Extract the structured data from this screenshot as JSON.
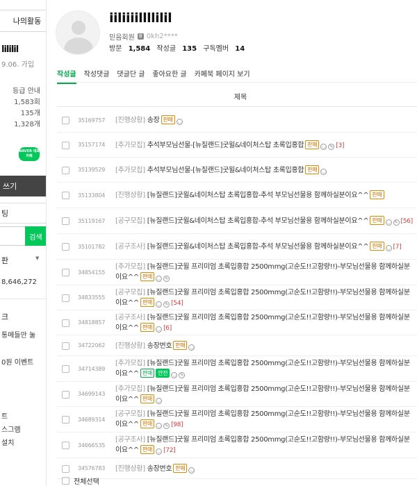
{
  "sidebar": {
    "tab_label": "나의활동",
    "nickname": "lililil",
    "join_date": "9.06. 가입",
    "grade_guide": "등급 안내",
    "visit_count": "1,583회",
    "post_count": "135개",
    "comment_count": "1,328개",
    "naver_badge": "NAVER 대표카페",
    "write_button": "쓰기",
    "box_label": "팅",
    "search_button": "검색",
    "section_label": "판",
    "member_count": "8,646,272",
    "section2_label": "크",
    "menu1": "통메들만 눌",
    "menu2": "0원 이벤트",
    "menu3": "트",
    "menu4": "스그램",
    "menu5": "설치"
  },
  "profile": {
    "nickname": "iiliiiillllilil",
    "grade": "믿음회원",
    "user_id": "0kh2****",
    "visit_label": "방문",
    "visit_value": "1,584",
    "posts_label": "작성글",
    "posts_value": "135",
    "subs_label": "구독멤버",
    "subs_value": "14"
  },
  "tabs": [
    {
      "label": "작성글"
    },
    {
      "label": "작성댓글"
    },
    {
      "label": "댓글단 글"
    },
    {
      "label": "좋아요한 글"
    },
    {
      "label": "카페북 페이지 보기"
    }
  ],
  "table_header": "제목",
  "rows": [
    {
      "id": "35169757",
      "cat": "[진행상황]",
      "text": "송장",
      "tags": [
        "판매"
      ],
      "icons": 1,
      "comments": ""
    },
    {
      "id": "35157174",
      "cat": "[추가모집]",
      "text": "추석부모님선물-[뉴질랜드]굿윌&네이처스탑 초록입홍합",
      "tags": [
        "판매"
      ],
      "icons": 2,
      "comments": "[3]"
    },
    {
      "id": "35139529",
      "cat": "[추가모집]",
      "text": "추석부모님선물-[뉴질랜드]굿윌&네이처스탑 초록입홍합",
      "tags": [
        "판매"
      ],
      "icons": 1,
      "comments": ""
    },
    {
      "id": "35133804",
      "cat": "[진행상황]",
      "text": "[뉴질랜드]굿윌&네이처스탑 초록입홍합-추석 부모님선물용 함께하실분이요^^",
      "tags": [
        "판매"
      ],
      "icons": 0,
      "comments": ""
    },
    {
      "id": "35119167",
      "cat": "[공구모집]",
      "text": "[뉴질랜드]굿윌&네이처스탑 초록입홍합-추석 부모님선물용 함께하실분이요^^",
      "tags": [
        "판매"
      ],
      "icons": 2,
      "comments": "[56]"
    },
    {
      "id": "35101782",
      "cat": "[공구조사]",
      "text": "[뉴질랜드]굿윌&네이처스탑 초록입홍합-추석 부모님선물용 함께하실분이요^^",
      "tags": [
        "판매"
      ],
      "icons": 1,
      "comments": "[7]"
    },
    {
      "id": "34854155",
      "cat": "[추가모집]",
      "text": "[뉴질랜드]굿윌 프리미엄 초록입홍합 2500mmg(고순도!!고함량!!)-부모님선물용 함께하실분이요^^",
      "tags": [
        "판매"
      ],
      "icons": 2,
      "comments": ""
    },
    {
      "id": "34833555",
      "cat": "[공구모집]",
      "text": "[뉴질랜드]굿윌 프리미엄 초록입홍합 2500mmg(고순도!!고함량!!)-부모님선물용 함께하실분이요^^",
      "tags": [
        "판매"
      ],
      "icons": 2,
      "comments": "[54]"
    },
    {
      "id": "34818857",
      "cat": "[공구조사]",
      "text": "[뉴질랜드]굿윌 프리미엄 초록입홍합 2500mmg(고순도!!고함량!!)-부모님선물용 함께하실분이요^^",
      "tags": [
        "판매"
      ],
      "icons": 1,
      "comments": "[6]"
    },
    {
      "id": "34722062",
      "cat": "[진행상황]",
      "text": "송장번호",
      "tags": [
        "판매"
      ],
      "icons": 1,
      "comments": ""
    },
    {
      "id": "34714389",
      "cat": "[추가모집]",
      "text": "[뉴질랜드]굿윌 프리미엄 초록입홍합 2500mmg(고순도!!고함량!!)-부모님선물용 함께하실분이요^^",
      "tags": [
        "판매",
        "안전"
      ],
      "icons": 2,
      "comments": ""
    },
    {
      "id": "34699143",
      "cat": "[추가모집]",
      "text": "[뉴질랜드]굿윌 프리미엄 초록입홍합 2500mmg(고순도!!고함량!!)-부모님선물용 함께하실분이요^^",
      "tags": [
        "판매"
      ],
      "icons": 1,
      "comments": ""
    },
    {
      "id": "34689314",
      "cat": "[공구모집]",
      "text": "[뉴질랜드]굿윌 프리미엄 초록입홍합 2500mmg(고순도!!고함량!!)-부모님선물용 함께하실분이요^^",
      "tags": [
        "판매"
      ],
      "icons": 2,
      "comments": "[98]"
    },
    {
      "id": "34666535",
      "cat": "[공구조사]",
      "text": "[뉴질랜드]굿윌 프리미엄 초록입홍합 2500mmg(고순도!!고함량!!)-부모님선물용 함께하실분이요^^",
      "tags": [
        "판매"
      ],
      "icons": 1,
      "comments": "[72]"
    },
    {
      "id": "34576783",
      "cat": "[진행상황]",
      "text": "송장번호",
      "tags": [
        "판매"
      ],
      "icons": 1,
      "comments": ""
    }
  ],
  "select_all": "전체선택",
  "colors": {
    "accent": "#03c75a",
    "tag_orange": "#d07000",
    "comment_red": "#e03a3a"
  }
}
